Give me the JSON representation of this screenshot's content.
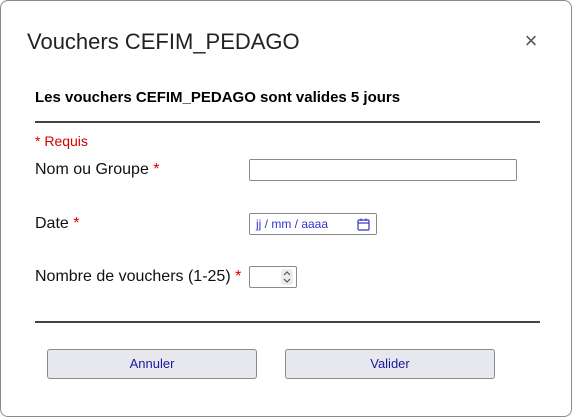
{
  "dialog": {
    "title": "Vouchers CEFIM_PEDAGO",
    "close_glyph": "×",
    "subtitle": "Les vouchers CEFIM_PEDAGO sont valides 5 jours",
    "required_note": "* Requis"
  },
  "form": {
    "name_label": "Nom ou Groupe",
    "name_value": "",
    "date_label": "Date",
    "date_placeholder": "jj / mm / aaaa",
    "count_label": "Nombre de vouchers (1-25)",
    "count_value": "",
    "required_marker": "*"
  },
  "buttons": {
    "cancel": "Annuler",
    "submit": "Valider"
  },
  "colors": {
    "required": "#d40000",
    "button_text": "#1a1aa0",
    "button_bg": "#e7e7ee"
  },
  "icons": {
    "close": "close-icon",
    "calendar": "calendar-icon",
    "spinner": "number-spinner-icon"
  }
}
